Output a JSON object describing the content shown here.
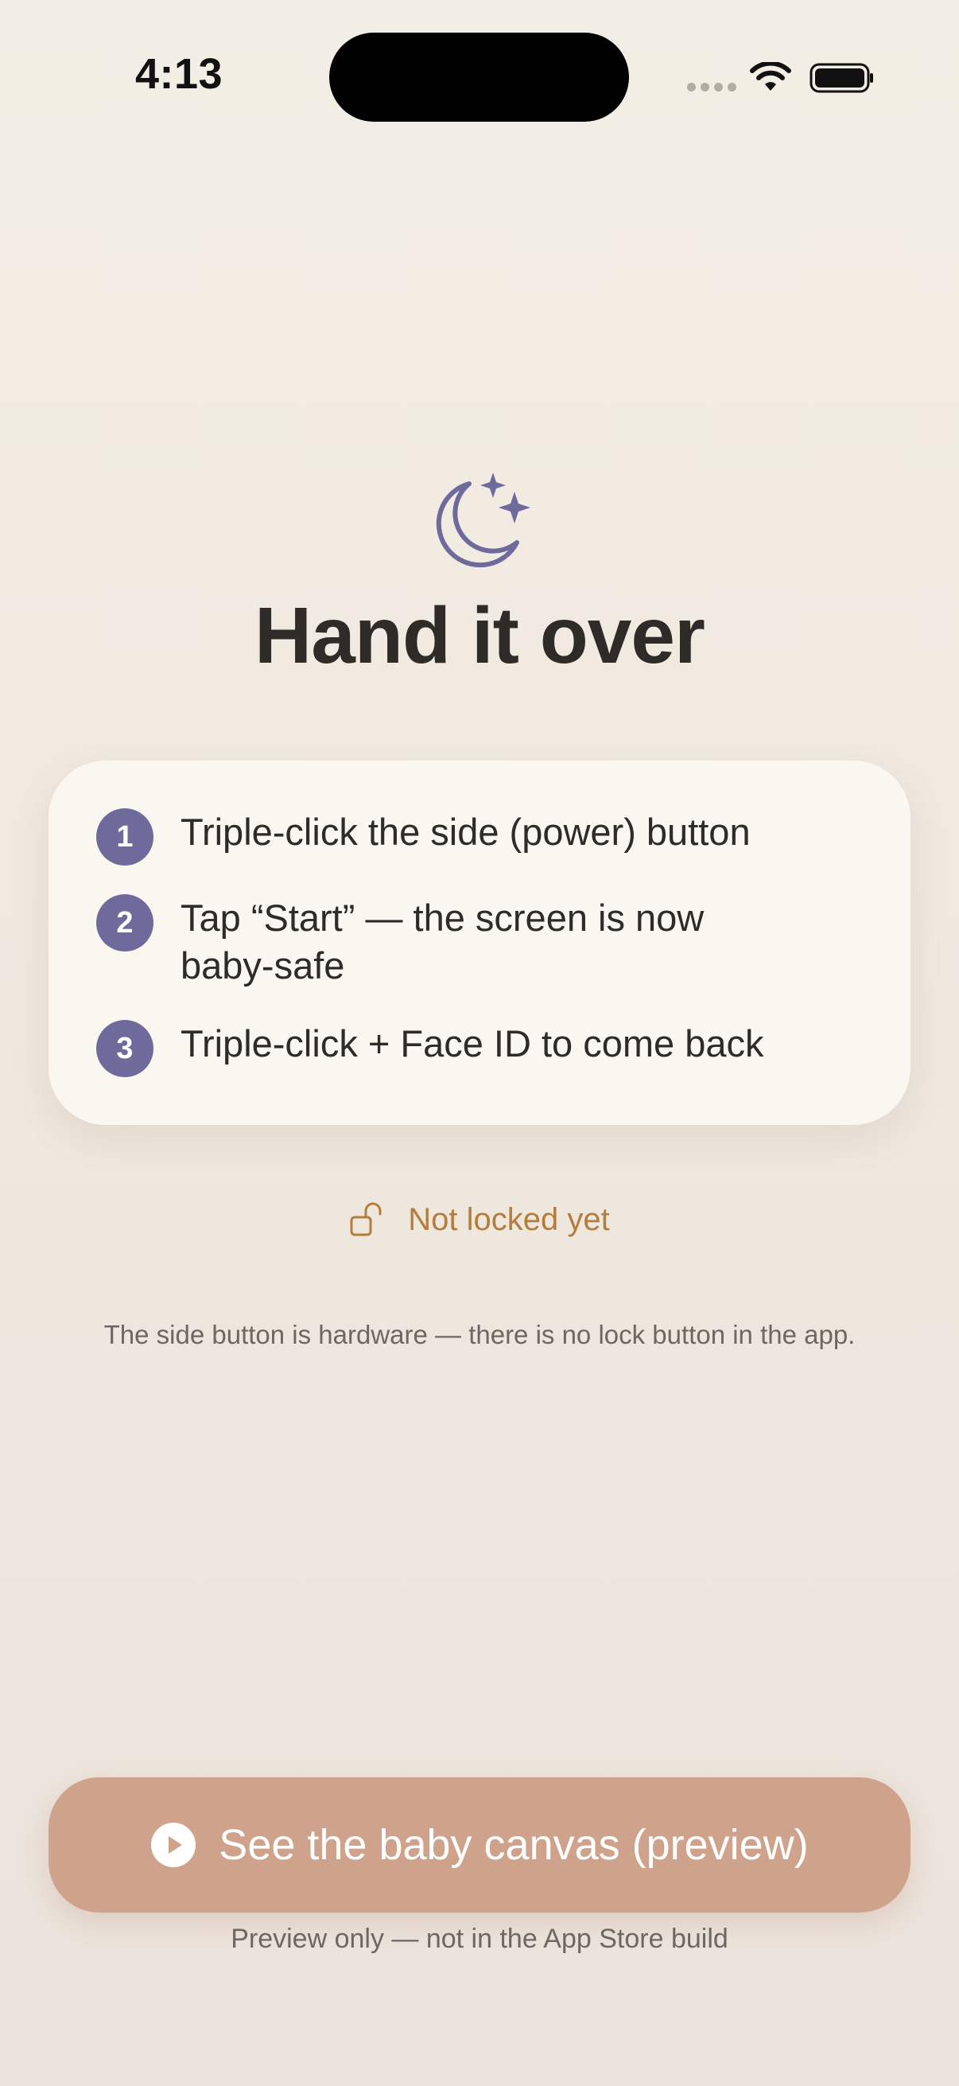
{
  "status_bar": {
    "time": "4:13"
  },
  "header": {
    "icon": "moon-stars-icon",
    "title": "Hand it over"
  },
  "steps": [
    {
      "number": "1",
      "text": "Triple-click the side (power) button"
    },
    {
      "number": "2",
      "text": "Tap “Start” — the screen is now baby-safe"
    },
    {
      "number": "3",
      "text": "Triple-click + Face ID to come back"
    }
  ],
  "lock_status": {
    "icon": "unlock-icon",
    "label": "Not locked yet"
  },
  "note": "The side button is hardware — there is no lock button in the app.",
  "preview": {
    "button_label": "See the baby canvas (preview)",
    "caption": "Preview only — not in the App Store build"
  },
  "colors": {
    "accent_purple": "#6e6a9b",
    "warning_orange": "#b57d3c",
    "button_bg": "#cfa38b"
  }
}
